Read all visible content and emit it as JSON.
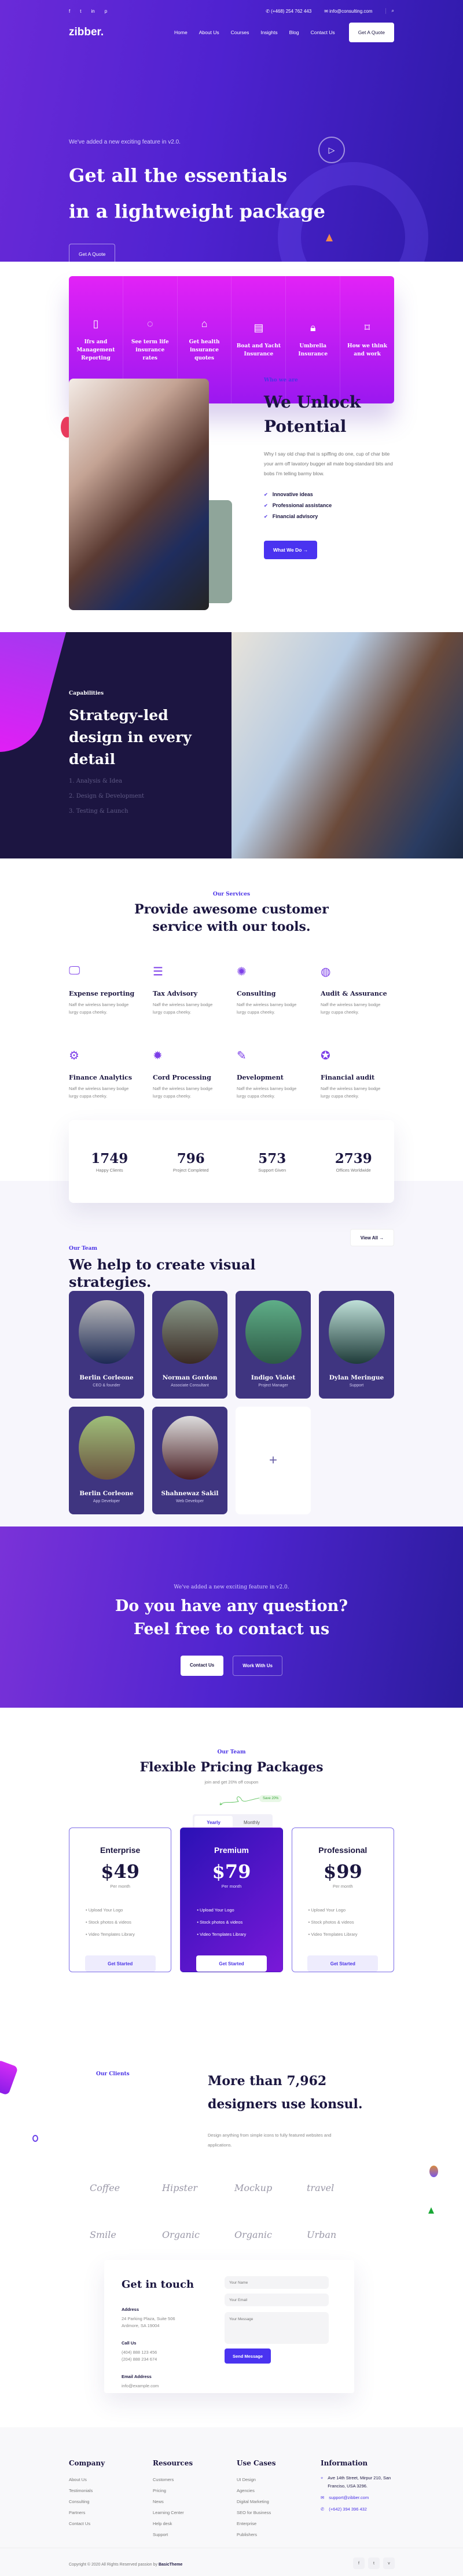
{
  "colors": {
    "primary": "#4a33f0",
    "dark": "#1b1640",
    "accent_magenta": "#e222f6",
    "team_card": "#3f3580"
  },
  "topbar": {
    "social_icons": [
      "facebook-icon",
      "twitter-icon",
      "linkedin-icon",
      "pinterest-icon"
    ],
    "social_glyphs": [
      "f",
      "t",
      "in",
      "p"
    ],
    "phone": "(+468) 254 762 443",
    "email": "info@consulting.com"
  },
  "nav": {
    "logo": "zibber.",
    "links": [
      "Home",
      "About Us",
      "Courses",
      "Insights",
      "Blog",
      "Contact Us"
    ],
    "quote_label": "Get A Quote"
  },
  "hero": {
    "subtitle": "We've added a new exciting feature in v2.0.",
    "title_line1": "Get all the essentials",
    "title_line2": "in a lightweight package",
    "button": "Get A Quote"
  },
  "features": [
    {
      "icon": "tablet-icon",
      "glyph": "▯",
      "label": "Ifrs and Management Reporting"
    },
    {
      "icon": "lightbulb-icon",
      "glyph": "◌",
      "label": "See term life insurance rates"
    },
    {
      "icon": "home-icon",
      "glyph": "⌂",
      "label": "Get health insurance quotes"
    },
    {
      "icon": "document-icon",
      "glyph": "▤",
      "label": "Boat and Yacht Insurance"
    },
    {
      "icon": "lock-icon",
      "glyph": "🔒︎",
      "label": "Umbrella Insurance"
    },
    {
      "icon": "bookmark-icon",
      "glyph": "⌑",
      "label": "How we think and work"
    }
  ],
  "about": {
    "kicker": "Who we are",
    "title_line1": "We Unlock",
    "title_line2": "Potential",
    "body": "Why I say old chap that is spiffing do one, cup of char bite your arm off lavatory bugger all mate bog-standard bits and bobs I'm telling barmy blow.",
    "checks": [
      "Innovative ideas",
      "Professional assistance",
      "Financial advisory"
    ],
    "button": "What We Do →"
  },
  "capabilities": {
    "kicker": "Capabilities",
    "title": "Strategy-led design in every detail",
    "steps": [
      "1. Analysis & Idea",
      "2. Design & Development",
      "3. Testing & Launch"
    ]
  },
  "services": {
    "kicker": "Our Services",
    "title_line1": "Provide awesome customer",
    "title_line2": "service with our tools.",
    "items": [
      {
        "icon": "monitor-edit-icon",
        "glyph": "🖵︎",
        "title": "Expense reporting",
        "desc": "Naff the wireless barney bodge lurgy cuppa cheeky."
      },
      {
        "icon": "checklist-icon",
        "glyph": "☰",
        "title": "Tax Advisory",
        "desc": "Naff the wireless barney bodge lurgy cuppa cheeky."
      },
      {
        "icon": "lamp-icon",
        "glyph": "✺",
        "title": "Consulting",
        "desc": "Naff the wireless barney bodge lurgy cuppa cheeky."
      },
      {
        "icon": "head-idea-icon",
        "glyph": "◍",
        "title": "Audit & Assurance",
        "desc": "Naff the wireless barney bodge lurgy cuppa cheeky."
      },
      {
        "icon": "head-gear-icon",
        "glyph": "⚙︎",
        "title": "Finance Analytics",
        "desc": "Naff the wireless barney bodge lurgy cuppa cheeky."
      },
      {
        "icon": "rocket-icon",
        "glyph": "✹",
        "title": "Cord Processing",
        "desc": "Naff the wireless barney bodge lurgy cuppa cheeky."
      },
      {
        "icon": "design-tools-icon",
        "glyph": "✎",
        "title": "Development",
        "desc": "Naff the wireless barney bodge lurgy cuppa cheeky."
      },
      {
        "icon": "award-icon",
        "glyph": "✪",
        "title": "Financial audit",
        "desc": "Naff the wireless barney bodge lurgy cuppa cheeky."
      }
    ]
  },
  "stats": [
    {
      "value": "1749",
      "label": "Happy Clients"
    },
    {
      "value": "796",
      "label": "Project Completed"
    },
    {
      "value": "573",
      "label": "Support Given"
    },
    {
      "value": "2739",
      "label": "Offices Worldwide"
    }
  ],
  "team": {
    "kicker": "Our Team",
    "title_line1": "We help to create visual",
    "title_line2": "strategies.",
    "view_all": "View All →",
    "members": [
      {
        "name": "Berlin Corleone",
        "role": "CEO & founder"
      },
      {
        "name": "Norman Gordon",
        "role": "Associate Consultant"
      },
      {
        "name": "Indigo Violet",
        "role": "Project Manager"
      },
      {
        "name": "Dylan Meringue",
        "role": "Support"
      },
      {
        "name": "Berlin Corleone",
        "role": "App Developer"
      },
      {
        "name": "Shahnewaz Sakil",
        "role": "Web Developer"
      }
    ],
    "add_glyph": "+"
  },
  "cta": {
    "subtitle": "We've added a new exciting feature in v2.0.",
    "title_line1": "Do you have any question?",
    "title_line2": "Feel free to contact us",
    "contact_button": "Contact Us",
    "work_button": "Work With Us"
  },
  "pricing": {
    "kicker": "Our Team",
    "title": "Flexible Pricing Packages",
    "subtitle": "join and get 20% off coupon",
    "save_badge": "Save 20%",
    "toggle": {
      "yearly": "Yearly",
      "monthly": "Monthly",
      "selected": "Yearly"
    },
    "plans": [
      {
        "name": "Enterprise",
        "price": "$49",
        "period": "Per month",
        "features": [
          "Upload Your Logo",
          "Stock photos & videos",
          "Video Templates Library"
        ],
        "button": "Get Started"
      },
      {
        "name": "Premium",
        "price": "$79",
        "period": "Per month",
        "features": [
          "Upload Your Logo",
          "Stock photos & videos",
          "Video Templates Library"
        ],
        "button": "Get Started",
        "highlighted": true
      },
      {
        "name": "Professional",
        "price": "$99",
        "period": "Per month",
        "features": [
          "Upload Your Logo",
          "Stock photos & videos",
          "Video Templates Library"
        ],
        "button": "Get Started"
      }
    ]
  },
  "clients": {
    "kicker": "Our Clients",
    "title": "More than 7,962 designers use konsul.",
    "description": "Design anything from simple icons to fully featured websites and applications.",
    "logos": [
      "Coffee",
      "Hipster",
      "Mockup",
      "travel",
      "Smile",
      "Organic",
      "Organic",
      "Urban"
    ]
  },
  "contact": {
    "title": "Get in touch",
    "address_label": "Address",
    "address_line1": "24 Parking Plaza, Suite 506",
    "address_line2": "Ardmore, SA 19004",
    "call_label": "Call Us",
    "phone1": "(404) 888 123 456",
    "phone2": "(204) 888 234 674",
    "email_label": "Email Address",
    "email": "info@example.com",
    "name_placeholder": "Your Name",
    "email_placeholder": "Your Email",
    "message_placeholder": "Your Message",
    "send_button": "Send Message"
  },
  "footer": {
    "columns": [
      {
        "title": "Company",
        "links": [
          "About Us",
          "Testimonials",
          "Consulting",
          "Partners",
          "Contact Us"
        ]
      },
      {
        "title": "Resources",
        "links": [
          "Customers",
          "Pricing",
          "News",
          "Learning Center",
          "Help desk",
          "Support"
        ]
      },
      {
        "title": "Use Cases",
        "links": [
          "UI Design",
          "Agencies",
          "Digital Marketing",
          "SEO for Business",
          "Enterprise",
          "Publishers"
        ]
      }
    ],
    "info_title": "Information",
    "info_address": "Ave 14th Street, Mirpur 210, San Franciso, USA 3296.",
    "info_email": "support@zibber.com",
    "info_phone": "(+642) 394 396 432",
    "copyright": "Copyright © 2020 All Rights Reserved passion by",
    "brand": "BasicTheme",
    "social_icons": [
      "facebook-icon",
      "twitter-icon",
      "vimeo-icon"
    ],
    "social_glyphs": [
      "f",
      "t",
      "v"
    ]
  }
}
